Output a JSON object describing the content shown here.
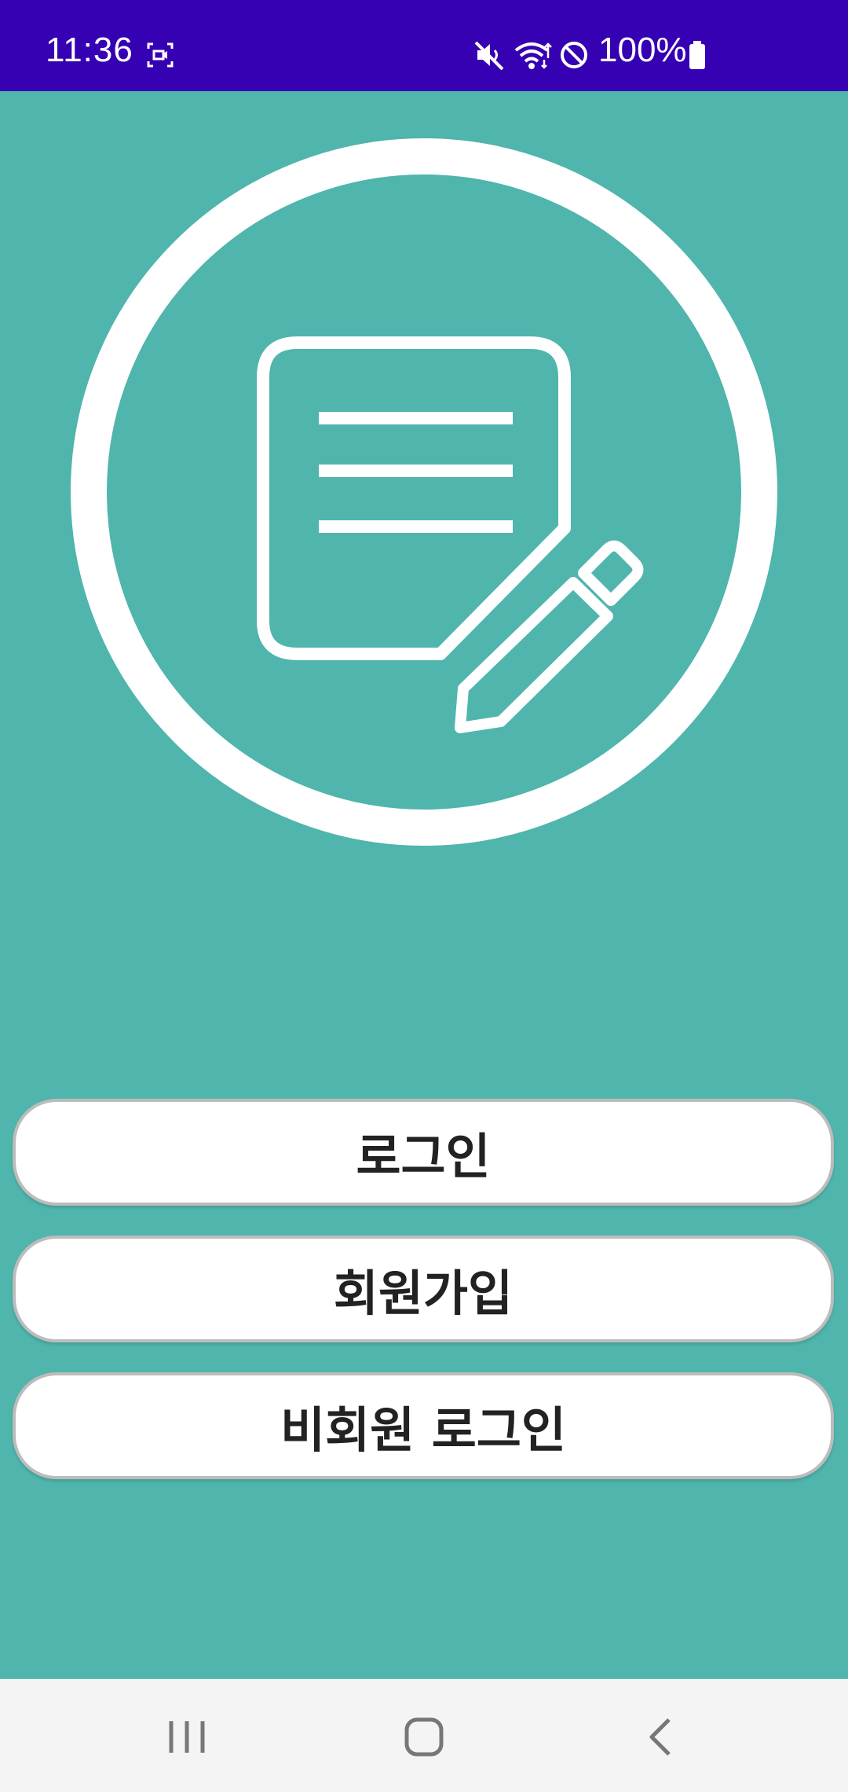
{
  "status_bar": {
    "time": "11:36",
    "battery": "100%",
    "icons": [
      "screen-record-icon",
      "mute-icon",
      "wifi-icon",
      "do-not-disturb-icon",
      "battery-icon"
    ],
    "background_color": "#3600b3"
  },
  "logo": {
    "icon": "note-edit-icon",
    "color": "#ffffff"
  },
  "buttons": {
    "login": "로그인",
    "signup": "회원가입",
    "guest_login": "비회원 로그인"
  },
  "nav_bar": {
    "icons": [
      "recents-icon",
      "home-icon",
      "back-icon"
    ]
  },
  "colors": {
    "background": "#4fb5ad",
    "button_bg": "#ffffff",
    "button_text": "#222222"
  }
}
